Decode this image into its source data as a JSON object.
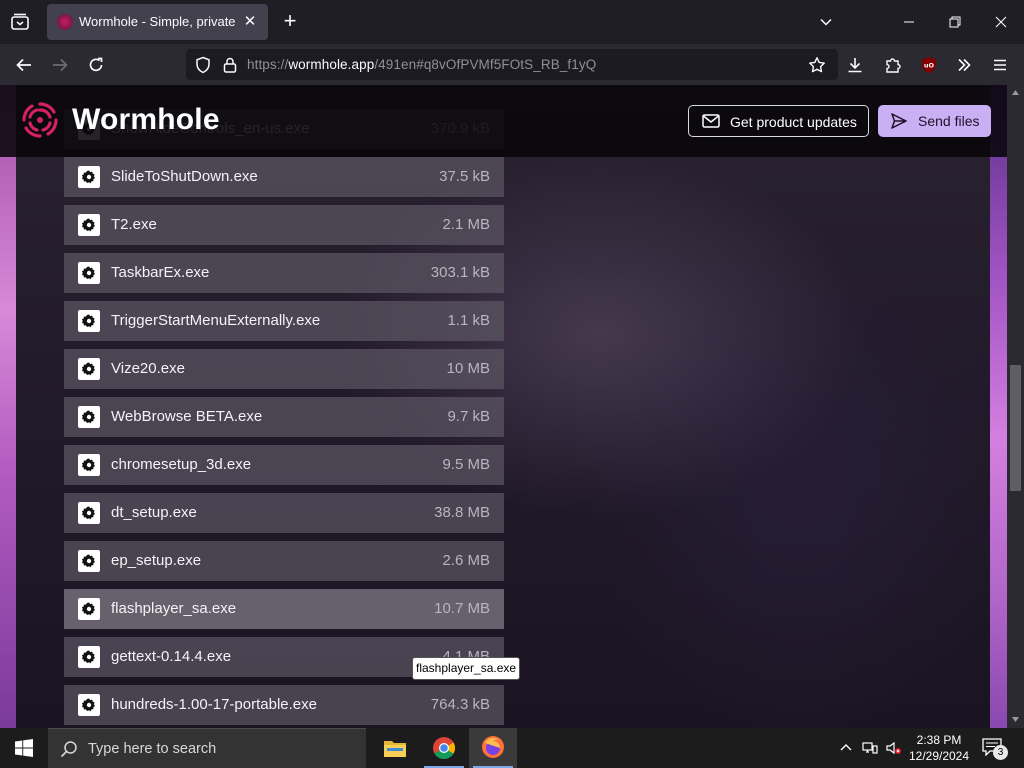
{
  "browser": {
    "tab": {
      "title": "Wormhole - Simple, private file sharing"
    },
    "url": {
      "scheme": "https://",
      "host": "wormhole.app",
      "path": "/491en#q8vOfPVMf5FOtS_RB_f1yQ"
    }
  },
  "site": {
    "logo_text": "Wormhole",
    "updates_button": "Get product updates",
    "send_button": "Send files"
  },
  "files": [
    {
      "name": "ShowHideControls_en-us.exe",
      "size": "370.9 kB"
    },
    {
      "name": "SlideToShutDown.exe",
      "size": "37.5 kB"
    },
    {
      "name": "T2.exe",
      "size": "2.1 MB"
    },
    {
      "name": "TaskbarEx.exe",
      "size": "303.1 kB"
    },
    {
      "name": "TriggerStartMenuExternally.exe",
      "size": "1.1 kB"
    },
    {
      "name": "Vize20.exe",
      "size": "10 MB"
    },
    {
      "name": "WebBrowse BETA.exe",
      "size": "9.7 kB"
    },
    {
      "name": "chromesetup_3d.exe",
      "size": "9.5 MB"
    },
    {
      "name": "dt_setup.exe",
      "size": "38.8 MB"
    },
    {
      "name": "ep_setup.exe",
      "size": "2.6 MB"
    },
    {
      "name": "flashplayer_sa.exe",
      "size": "10.7 MB"
    },
    {
      "name": "gettext-0.14.4.exe",
      "size": "4.1 MB"
    },
    {
      "name": "hundreds-1.00-17-portable.exe",
      "size": "764.3 kB"
    }
  ],
  "tooltip": "flashplayer_sa.exe",
  "taskbar": {
    "search_placeholder": "Type here to search",
    "time": "2:38 PM",
    "date": "12/29/2024",
    "notification_count": "3"
  },
  "colors": {
    "send_button_bg": "#c9b0f5",
    "brand_accent": "#c41f5c"
  }
}
